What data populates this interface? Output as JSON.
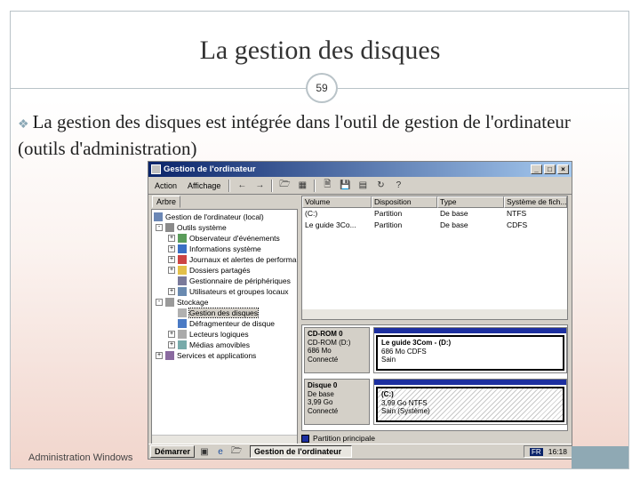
{
  "slide": {
    "title": "La gestion des disques",
    "number": "59",
    "bullet": "La gestion des disques est intégrée dans l'outil de gestion de l'ordinateur (outils d'administration)",
    "footer": "Administration Windows"
  },
  "window": {
    "title": "Gestion de l'ordinateur",
    "menu": [
      "Action",
      "Affichage"
    ],
    "tree_tab": "Arbre",
    "tree": [
      "Gestion de l'ordinateur (local)",
      "Outils système",
      "Observateur d'événements",
      "Informations système",
      "Journaux et alertes de performar",
      "Dossiers partagés",
      "Gestionnaire de périphériques",
      "Utilisateurs et groupes locaux",
      "Stockage",
      "Gestion des disques",
      "Défragmenteur de disque",
      "Lecteurs logiques",
      "Médias amovibles",
      "Services et applications"
    ],
    "columns": [
      "Volume",
      "Disposition",
      "Type",
      "Système de fich..."
    ],
    "volumes": [
      {
        "volume": "(C:)",
        "disposition": "Partition",
        "type": "De base",
        "fs": "NTFS"
      },
      {
        "volume": "Le guide 3Co...",
        "disposition": "Partition",
        "type": "De base",
        "fs": "CDFS"
      }
    ],
    "disks": [
      {
        "name": "CD-ROM 0",
        "lines": [
          "CD-ROM (D:)",
          "686 Mo",
          "Connecté"
        ],
        "partition_title": "Le guide 3Com - (D:)",
        "partition_lines": [
          "686 Mo CDFS",
          "Sain"
        ]
      },
      {
        "name": "Disque 0",
        "lines": [
          "De base",
          "3,99 Go",
          "Connecté"
        ],
        "partition_title": "(C:)",
        "partition_lines": [
          "3,99 Go NTFS",
          "Sain (Système)"
        ]
      }
    ],
    "legend": "Partition principale",
    "taskbar": {
      "start": "Démarrer",
      "task": "Gestion de l'ordinateur",
      "lang": "FR",
      "clock": "16:18"
    }
  },
  "colors": {
    "titlebar": "#0a246a",
    "partition": "#1c2fa0",
    "slide_border": "#b9c3c8"
  }
}
